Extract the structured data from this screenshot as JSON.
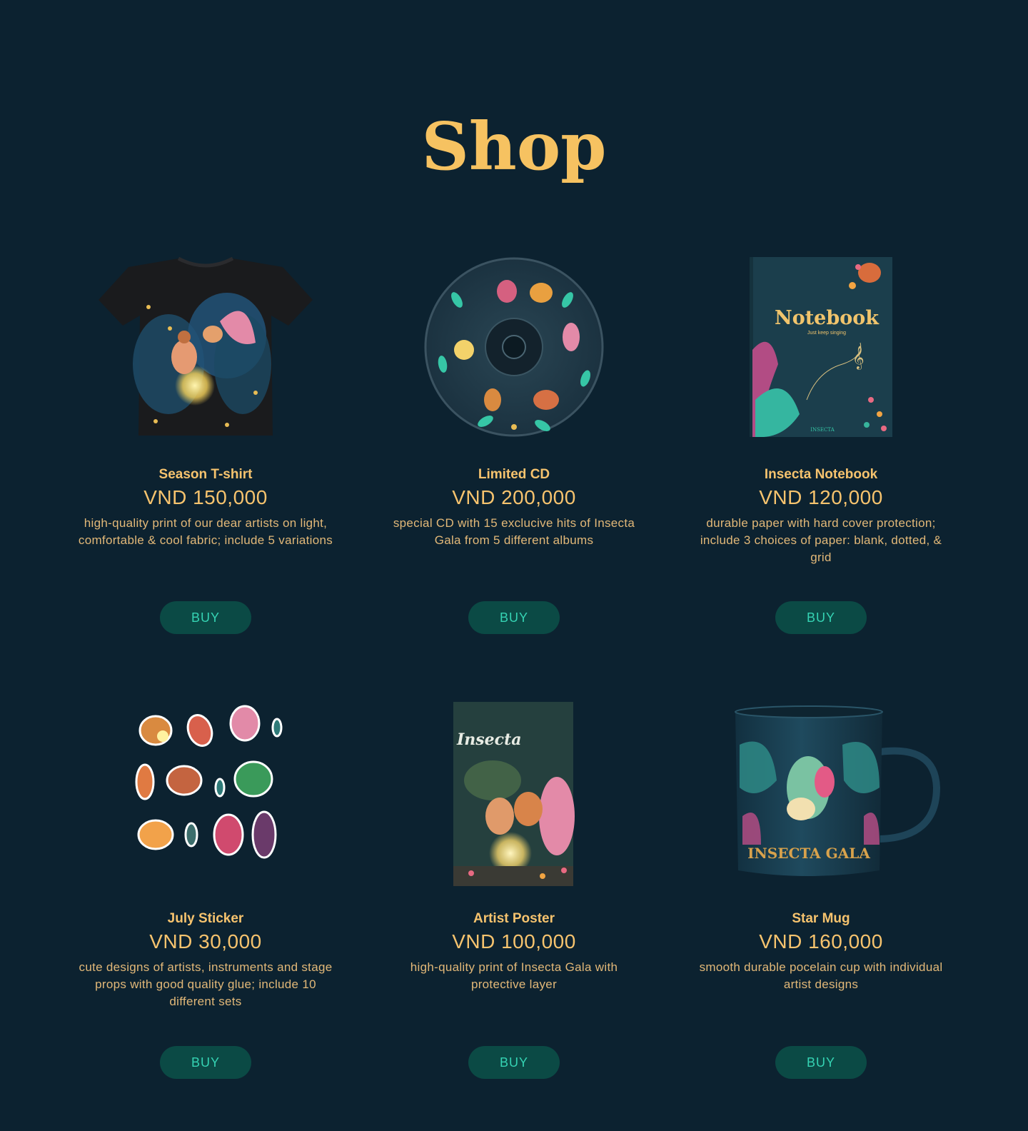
{
  "page": {
    "title": "Shop"
  },
  "theme": {
    "background": "#0c2230",
    "accent": "#f6c261",
    "button_bg": "#0b4a45",
    "button_text": "#35d3b3"
  },
  "products": [
    {
      "name": "Season T-shirt",
      "price": "VND 150,000",
      "description": "high-quality print of our dear artists on light, comfortable & cool fabric; include 5 variations",
      "buy_label": "BUY",
      "image": "tshirt-image"
    },
    {
      "name": "Limited CD",
      "price": "VND 200,000",
      "description": "special CD with 15 exclucive hits of Insecta Gala from 5 different albums",
      "buy_label": "BUY",
      "image": "cd-image"
    },
    {
      "name": "Insecta Notebook",
      "price": "VND 120,000",
      "description": "durable paper with hard cover protection; include 3 choices of paper: blank, dotted, & grid",
      "buy_label": "BUY",
      "image": "notebook-image",
      "image_text": {
        "title": "Notebook",
        "subtitle": "Just keep singing",
        "brand": "INSECTA"
      }
    },
    {
      "name": "July Sticker",
      "price": "VND 30,000",
      "description": "cute designs of artists, instruments and stage props with good quality glue; include 10 different sets",
      "buy_label": "BUY",
      "image": "sticker-sheet-image"
    },
    {
      "name": "Artist Poster",
      "price": "VND 100,000",
      "description": "high-quality print of Insecta Gala with protective layer",
      "buy_label": "BUY",
      "image": "poster-image",
      "image_text": {
        "title": "Insecta"
      }
    },
    {
      "name": "Star Mug",
      "price": "VND 160,000",
      "description": "smooth durable pocelain cup with individual artist designs",
      "buy_label": "BUY",
      "image": "mug-image",
      "image_text": {
        "title": "INSECTA GALA"
      }
    }
  ]
}
